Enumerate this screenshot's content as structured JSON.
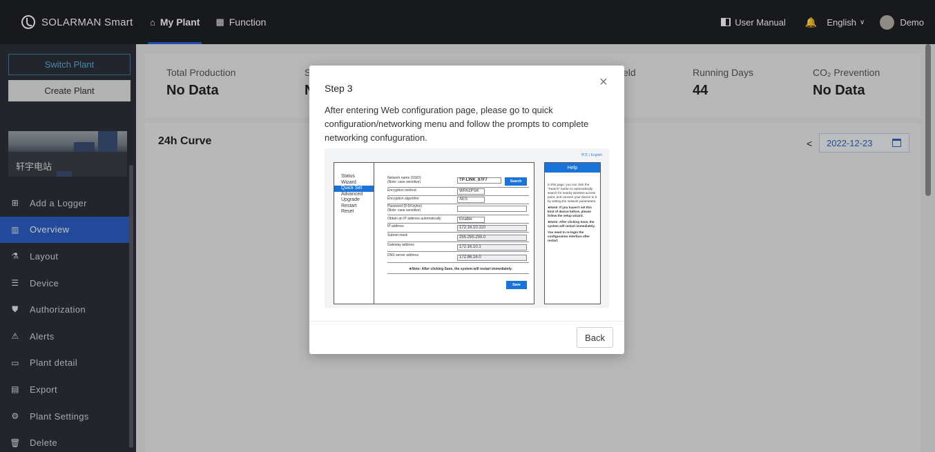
{
  "app": {
    "brand": "SOLARMAN Smart"
  },
  "topnav": {
    "tabs": [
      {
        "label": "My Plant"
      },
      {
        "label": "Function"
      }
    ],
    "user_manual": "User Manual",
    "language": "English",
    "user": "Demo"
  },
  "sidebar": {
    "switch_plant": "Switch Plant",
    "create_plant": "Create Plant",
    "plant_name": "轩宇电站",
    "items": [
      {
        "label": "Add a Logger",
        "icon": "plus-square-icon"
      },
      {
        "label": "Overview",
        "icon": "chart-icon"
      },
      {
        "label": "Layout",
        "icon": "layout-icon"
      },
      {
        "label": "Device",
        "icon": "device-icon"
      },
      {
        "label": "Authorization",
        "icon": "shield-icon"
      },
      {
        "label": "Alerts",
        "icon": "alarm-icon"
      },
      {
        "label": "Plant detail",
        "icon": "folder-icon"
      },
      {
        "label": "Export",
        "icon": "export-icon"
      },
      {
        "label": "Plant Settings",
        "icon": "gear-icon"
      },
      {
        "label": "Delete",
        "icon": "trash-icon"
      }
    ]
  },
  "stats": {
    "total_production": {
      "label": "Total Production",
      "value": "No Data"
    },
    "second_label_start": "S",
    "second_value_start": "N",
    "yield_fragment": "eld",
    "running_days": {
      "label": "Running Days",
      "value": "44"
    },
    "co2": {
      "label": "CO₂ Prevention",
      "value": "No Data"
    }
  },
  "curve": {
    "title": "24h Curve",
    "prev": "<",
    "date": "2022-12-23"
  },
  "modal": {
    "title": "Step 3",
    "close": "×",
    "text": "After entering Web configuration page, please go to quick configuration/networking menu and follow the prompts to complete networking confuguration.",
    "back": "Back"
  },
  "router": {
    "lang": "中文 | English",
    "menu": [
      "Status",
      "Wizard",
      "Quick Set",
      "Advanced",
      "Upgrade",
      "Restart",
      "Reset"
    ],
    "rows": {
      "ssid_label": "Network name (SSID)",
      "ssid_note": "(Note: case sensitive)",
      "enc_method": "Encryption method",
      "enc_algo": "Encryption algorithm",
      "pwd_label": "Password (8-64 bytes)",
      "pwd_note": "(Note: case sensitive)",
      "obtain_ip": "Obtain an IP address automatically",
      "ip": "IP address",
      "mask": "Subnet mask",
      "gateway": "Gateway address",
      "dns": "DNS server address"
    },
    "values": {
      "ssid": "TP-LINK_87F7",
      "enc_method": "WPA2PSK",
      "enc_algo": "AES",
      "obtain": "Enable",
      "ip": "172.16.10.110",
      "mask": "255.255.255.0",
      "gateway": "172.16.10.1",
      "dns": "172.86.16.0"
    },
    "search_btn": "Search",
    "save_btn": "Save",
    "note": "★Note: After clicking Save, the system will restart immediately.",
    "help_title": "Help",
    "help_p1": "In this page, you can click the \"Search\" button to automatically search for nearby wireless access point, and connect your device to it by setting the network parameters.",
    "help_p2": "★Note: If you haven't set this kind of device before, please follow the setup wizard.",
    "help_p3": "★Note: After clicking Save, the system will restart immediately.",
    "help_p4": "You need to re-login the configuration interface after restart."
  }
}
